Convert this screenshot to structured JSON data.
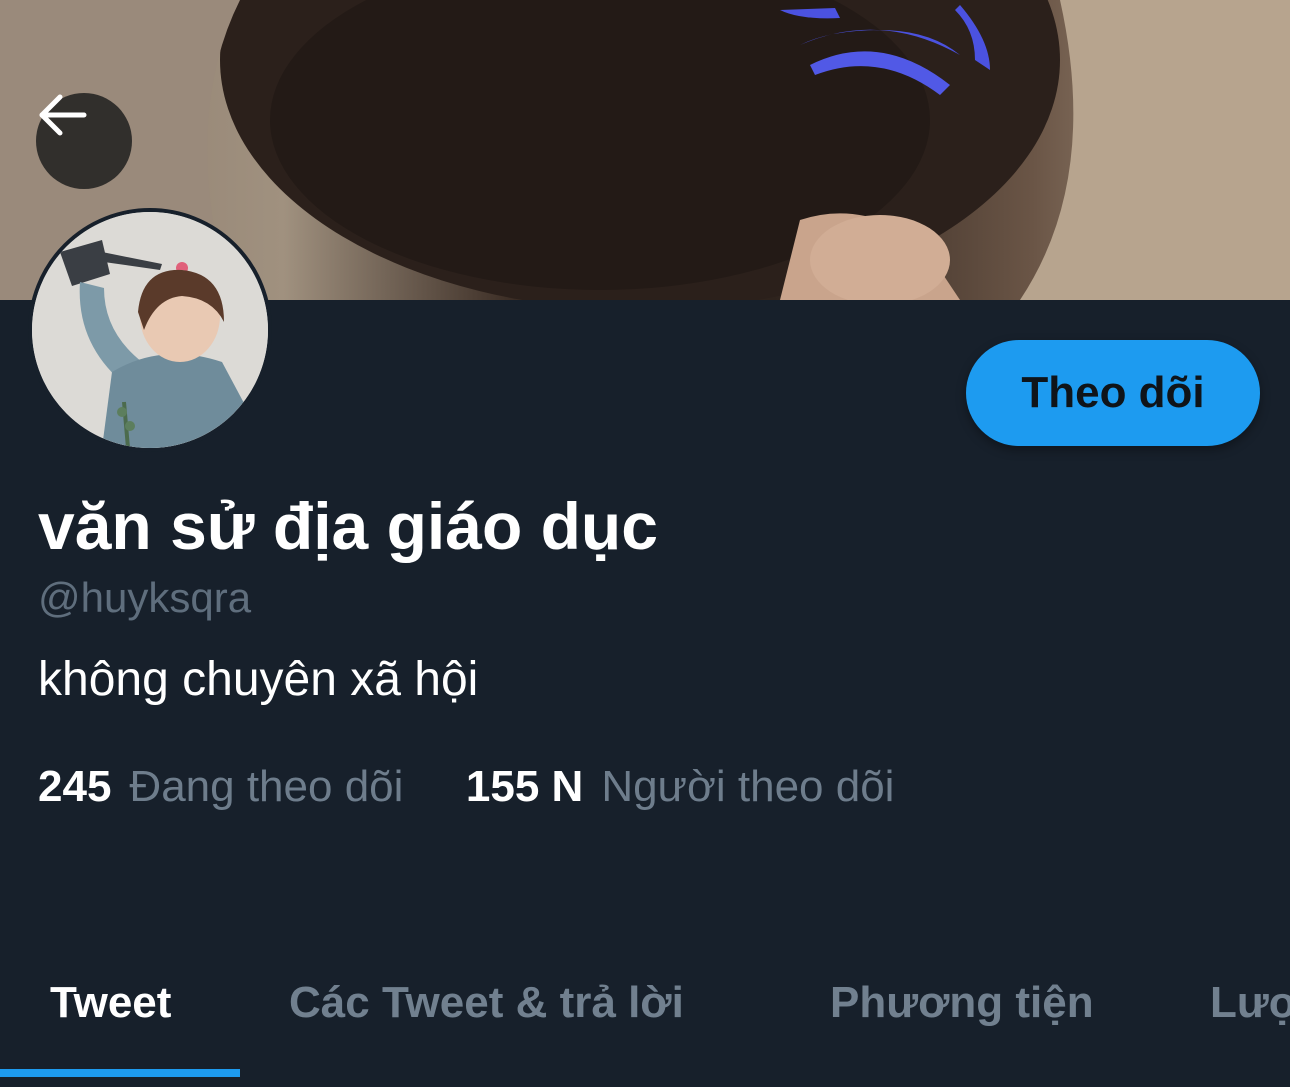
{
  "header": {
    "back_icon": "arrow-left-icon"
  },
  "profile": {
    "follow_label": "Theo dõi",
    "display_name": "văn sử địa giáo dục",
    "handle": "@huyksqra",
    "bio": "không chuyên xã hội",
    "following_count": "245",
    "following_label": "Đang theo dõi",
    "followers_count": "155 N",
    "followers_label": "Người theo dõi"
  },
  "tabs": [
    {
      "label": "Tweet",
      "active": true
    },
    {
      "label": "Các Tweet & trả lời",
      "active": false
    },
    {
      "label": "Phương tiện",
      "active": false
    },
    {
      "label": "Lượt thích",
      "active": false
    }
  ],
  "colors": {
    "background": "#17202b",
    "accent": "#1d9bf0",
    "muted_text": "#6e7d8c"
  }
}
